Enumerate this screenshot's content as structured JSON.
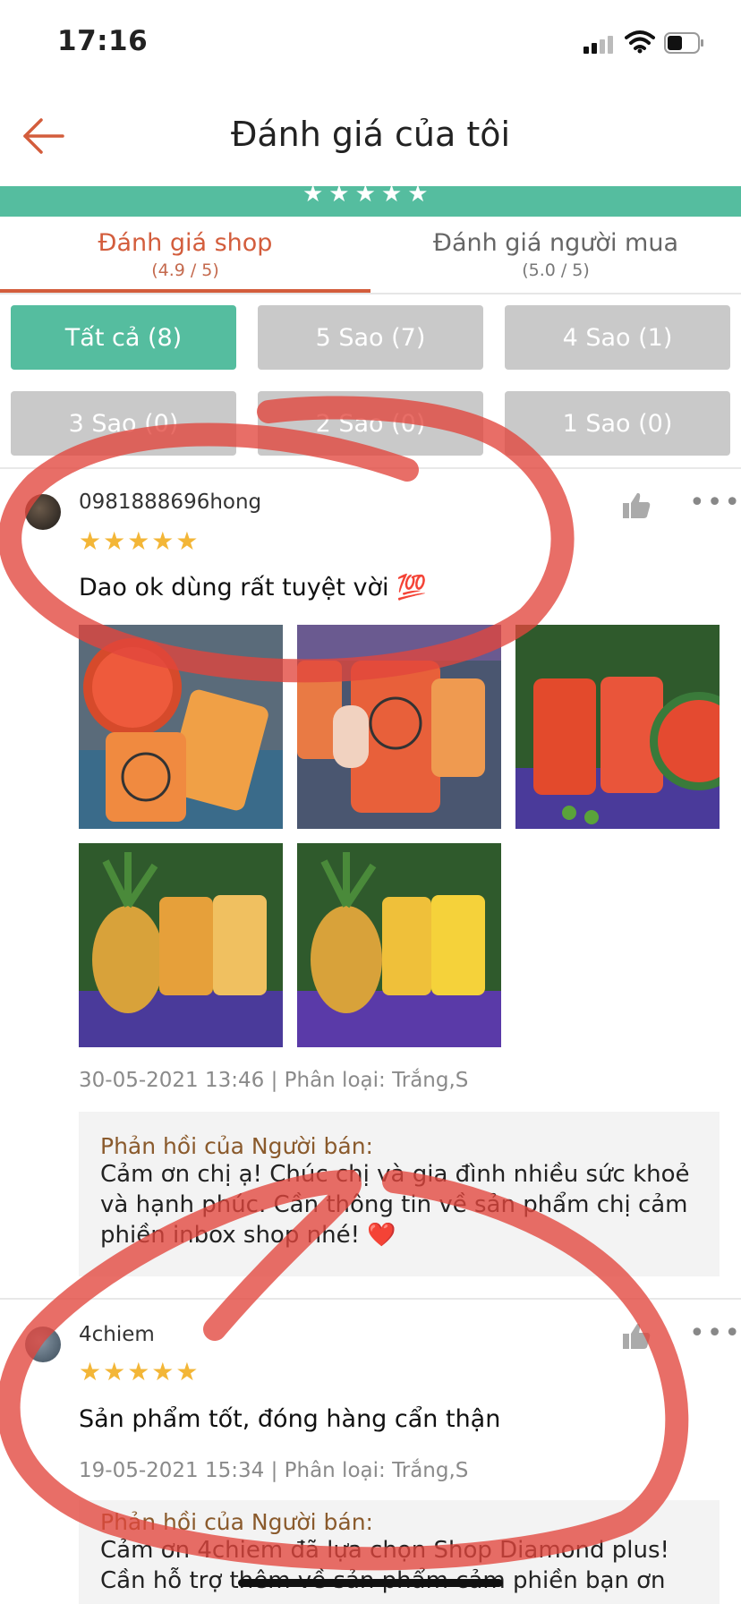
{
  "status_bar": {
    "time": "17:16"
  },
  "header": {
    "title": "Đánh giá của tôi",
    "banner_stars": "★★★★★"
  },
  "tabs": [
    {
      "label": "Đánh giá shop",
      "sub": "(4.9 / 5)",
      "active": true
    },
    {
      "label": "Đánh giá người mua",
      "sub": "(5.0 / 5)",
      "active": false
    }
  ],
  "filters": [
    {
      "label": "Tất cả (8)",
      "active": true
    },
    {
      "label": "5 Sao (7)",
      "active": false
    },
    {
      "label": "4 Sao (1)",
      "active": false
    },
    {
      "label": "3 Sao (0)",
      "active": false
    },
    {
      "label": "2 Sao (0)",
      "active": false
    },
    {
      "label": "1 Sao (0)",
      "active": false
    }
  ],
  "reviews": [
    {
      "username": "0981888696hong",
      "stars": "★★★★★",
      "rating": 5,
      "text": "Dao ok dùng rất tuyệt vời 💯",
      "meta": "30-05-2021 13:46 | Phân loại: Trắng,S",
      "reply_title": "Phản hồi của Người bán:",
      "reply_lines": [
        "Cảm ơn chị ạ! Chúc chị và gia đình nhiều sức khoẻ",
        "và hạnh phúc. Cần thông tin về sản phẩm chị cảm",
        "phiền inbox shop nhé! ❤️"
      ]
    },
    {
      "username": "4chiem",
      "stars": "★★★★★",
      "rating": 5,
      "text": "Sản phẩm tốt, đóng hàng cẩn thận",
      "meta": "19-05-2021 15:34 | Phân loại: Trắng,S",
      "reply_title": "Phản hồi của Người bán:",
      "reply_lines": [
        "Cảm ơn 4chiem đã lựa chọn Shop Diamond plus!",
        "Cần hỗ trợ thêm về sản phẩm cảm phiền bạn ơn"
      ]
    }
  ],
  "icons": {
    "back": "back-arrow-icon",
    "like": "thumbs-up-icon",
    "more": "more-dots-icon"
  },
  "colors": {
    "accent": "#d35d3c",
    "teal": "#55bd9f",
    "star": "#f3b637",
    "annotation": "#e2453c"
  }
}
